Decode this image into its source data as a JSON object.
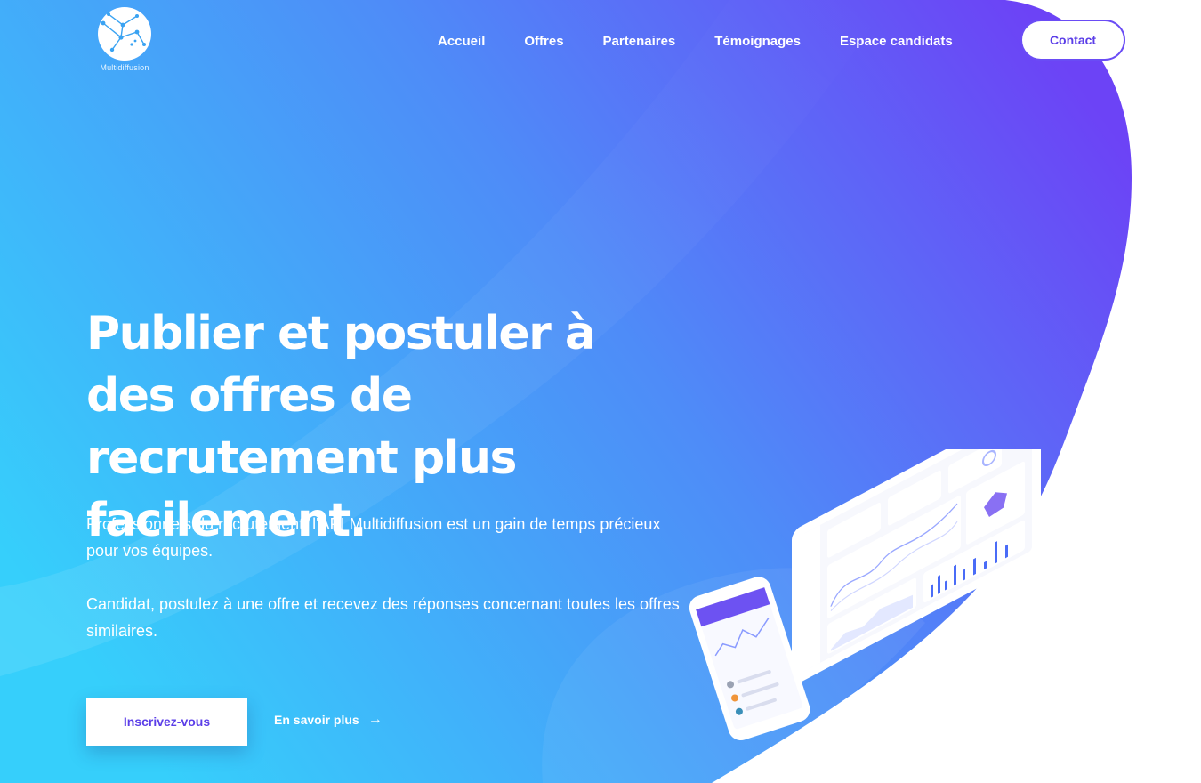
{
  "brand": {
    "name": "Multidiffusion"
  },
  "nav": {
    "items": [
      {
        "label": "Accueil"
      },
      {
        "label": "Offres"
      },
      {
        "label": "Partenaires"
      },
      {
        "label": "Témoignages"
      },
      {
        "label": "Espace candidats"
      }
    ],
    "contact_label": "Contact"
  },
  "hero": {
    "title": "Publier et postuler à des offres de recrutement plus facilement.",
    "paragraph_1": "Professionnels du recrutement, l'API Multidiffusion est un gain de temps précieux pour vos équipes.",
    "paragraph_2": "Candidat, postulez à une offre et recevez des réponses concernant toutes les offres similaires.",
    "primary_cta": "Inscrivez-vous",
    "secondary_cta": "En savoir plus",
    "secondary_cta_icon": "arrow-right-icon"
  },
  "colors": {
    "gradient_start": "#36cffb",
    "gradient_end": "#6c43f6",
    "accent": "#5b3ee8",
    "white": "#ffffff"
  }
}
